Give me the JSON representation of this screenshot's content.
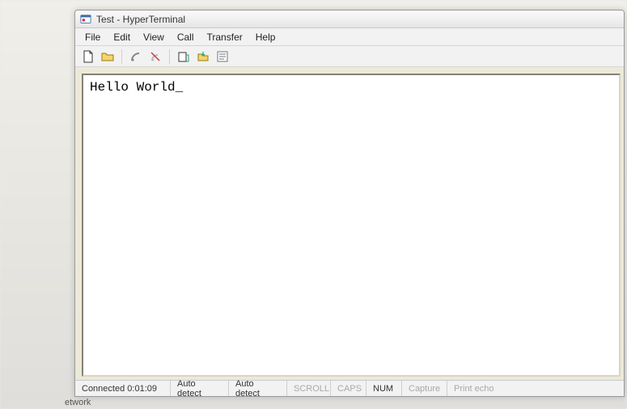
{
  "window": {
    "title": "Test - HyperTerminal"
  },
  "menu": {
    "items": [
      "File",
      "Edit",
      "View",
      "Call",
      "Transfer",
      "Help"
    ]
  },
  "toolbar": {
    "icons": [
      "new-file-icon",
      "open-folder-icon",
      "connect-icon",
      "disconnect-icon",
      "send-icon",
      "receive-icon",
      "properties-icon"
    ]
  },
  "terminal": {
    "content": "Hello World",
    "cursor": "_"
  },
  "status": {
    "connected_label": "Connected",
    "elapsed": "0:01:09",
    "auto_detect_1": "Auto detect",
    "auto_detect_2": "Auto detect",
    "scroll": "SCROLL",
    "caps": "CAPS",
    "num": "NUM",
    "capture": "Capture",
    "print_echo": "Print echo"
  },
  "background": {
    "partial_label": "etwork"
  }
}
